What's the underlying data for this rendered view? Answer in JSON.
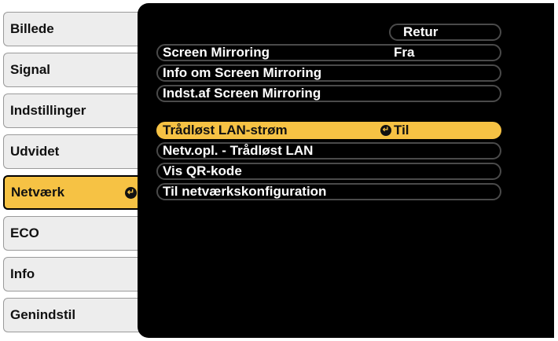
{
  "sidebar": {
    "items": [
      {
        "label": "Billede"
      },
      {
        "label": "Signal"
      },
      {
        "label": "Indstillinger"
      },
      {
        "label": "Udvidet"
      },
      {
        "label": "Netværk",
        "active": true
      },
      {
        "label": "ECO"
      },
      {
        "label": "Info"
      },
      {
        "label": "Genindstil"
      }
    ],
    "active_icon": "enter-icon"
  },
  "panel": {
    "return_label": "Retur",
    "group1": [
      {
        "label": "Screen Mirroring",
        "value": "Fra"
      },
      {
        "label": "Info om Screen Mirroring"
      },
      {
        "label": "Indst.af Screen Mirroring"
      }
    ],
    "group2": [
      {
        "label": "Trådløst LAN-strøm",
        "value": "Til",
        "selected": true,
        "value_icon": "enter-icon"
      },
      {
        "label": "Netv.opl. - Trådløst LAN"
      },
      {
        "label": "Vis QR-kode"
      },
      {
        "label": "Til netværkskonfiguration"
      }
    ]
  },
  "colors": {
    "accent": "#f6c244",
    "panel_bg": "#000000",
    "tab_bg": "#ededed"
  }
}
